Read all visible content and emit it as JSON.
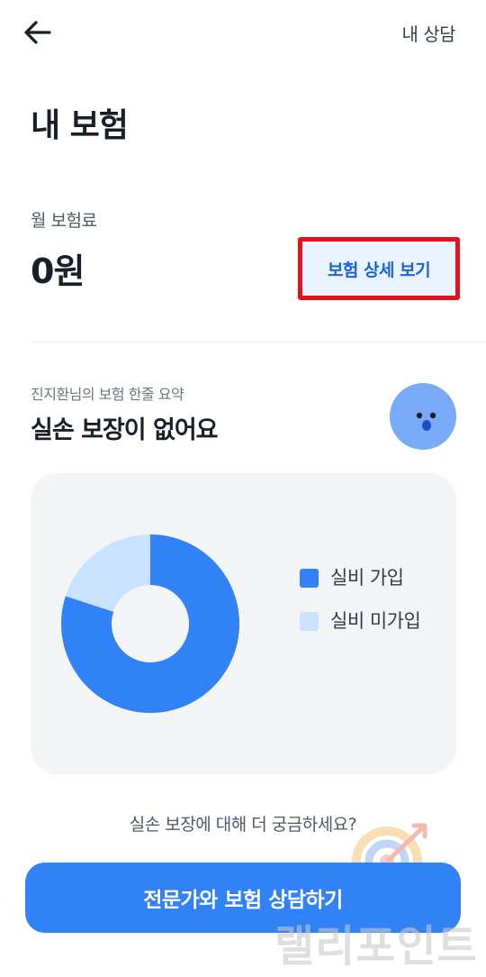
{
  "header": {
    "back_icon": "arrow-left-icon",
    "consult_link": "내 상담"
  },
  "page": {
    "title": "내 보험"
  },
  "premium": {
    "label": "월 보험료",
    "value": "0원",
    "detail_button": "보험 상세 보기"
  },
  "summary": {
    "label": "진지환님의 보험 한줄 요약",
    "title": "실손 보장이 없어요",
    "avatar_icon": "surprised-face-icon"
  },
  "chart_data": {
    "type": "pie",
    "categories": [
      "실비 가입",
      "실비 미가입"
    ],
    "values": [
      80,
      20
    ],
    "colors": [
      "#3182f6",
      "#c9e2ff"
    ],
    "donut": true,
    "legend_position": "right"
  },
  "footer": {
    "question": "실손 보장에 대해 더 궁금하세요?",
    "cta_button": "전문가와 보험 상담하기"
  },
  "watermark": {
    "text": "랠리포인트",
    "icon": "target-arrow-icon"
  },
  "colors": {
    "accent": "#3182f6",
    "accent_light": "#c9e2ff",
    "highlight_border": "#e5111b",
    "card_bg": "#f2f4f6"
  }
}
